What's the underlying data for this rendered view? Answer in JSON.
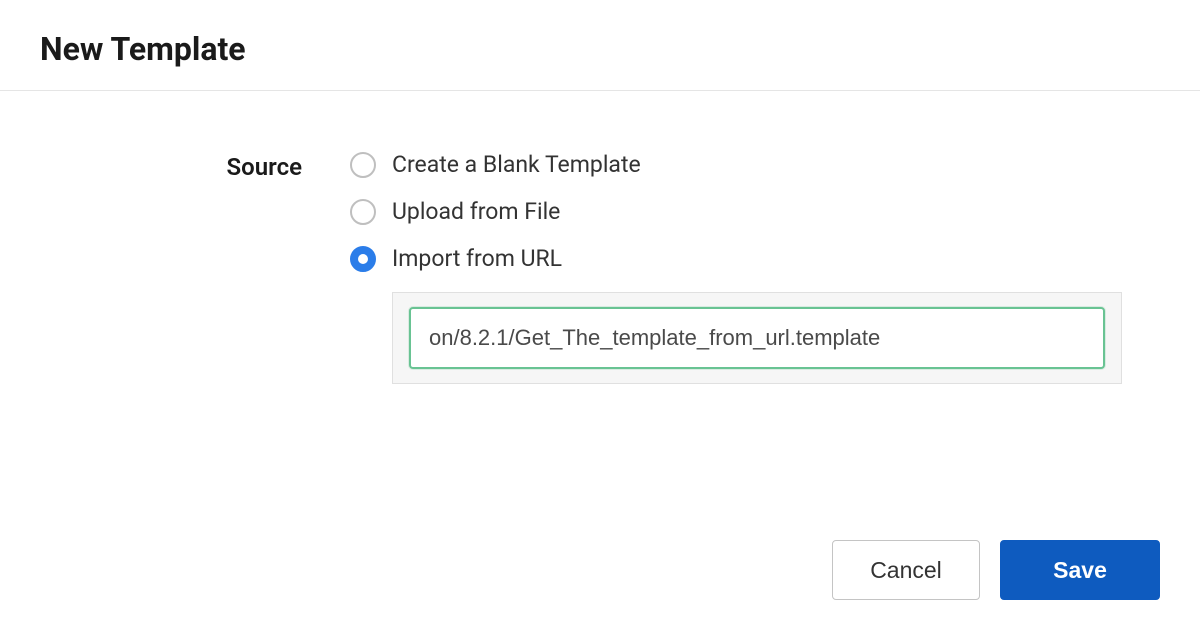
{
  "modal": {
    "title": "New Template"
  },
  "form": {
    "source_label": "Source",
    "options": {
      "blank": "Create a Blank Template",
      "upload": "Upload from File",
      "import": "Import from URL"
    },
    "selected": "import",
    "url_value": "on/8.2.1/Get_The_template_from_url.template"
  },
  "buttons": {
    "cancel": "Cancel",
    "save": "Save"
  }
}
